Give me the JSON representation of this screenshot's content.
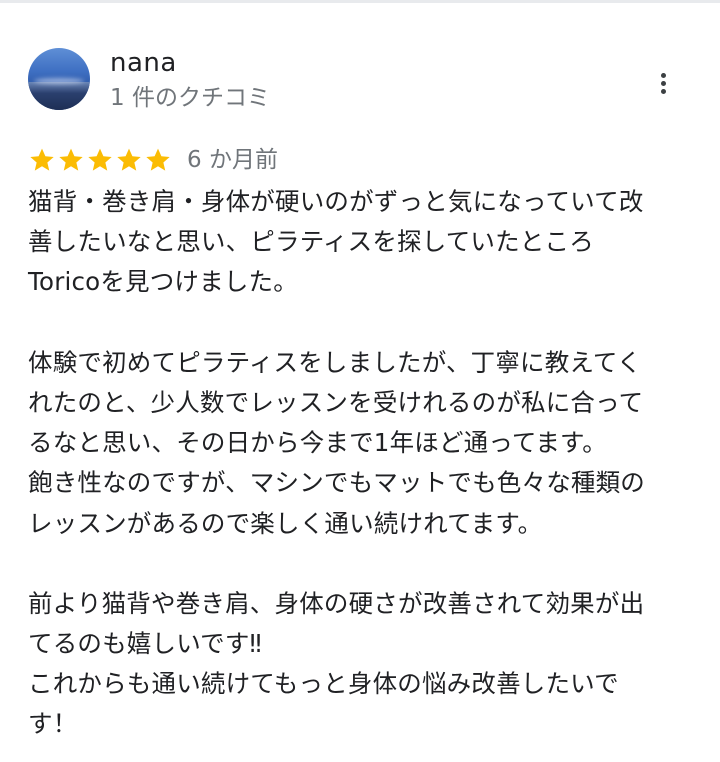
{
  "review": {
    "reviewer_name": "nana",
    "reviewer_meta": "1 件のクチコミ",
    "rating": 5,
    "rating_max": 5,
    "date": "6 か月前",
    "body_lines": [
      "猫背・巻き肩・身体が硬いのがずっと気になっていて改",
      "善したいなと思い、ピラティスを探していたところ",
      "Toricoを見つけました。",
      "",
      "体験で初めてピラティスをしましたが、丁寧に教えてく",
      "れたのと、少人数でレッスンを受けれるのが私に合って",
      "るなと思い、その日から今まで1年ほど通ってます。",
      "飽き性なのですが、マシンでもマットでも色々な種類の",
      "レッスンがあるので楽しく通い続けれてます。",
      "",
      "前より猫背や巻き肩、身体の硬さが改善されて効果が出",
      "てるのも嬉しいです‼",
      "これからも通い続けてもっと身体の悩み改善したいで",
      "す！"
    ]
  },
  "colors": {
    "star": "#fbbc04",
    "text_primary": "#202124",
    "text_secondary": "#70757a"
  },
  "icons": {
    "more": "more-vert-icon",
    "star": "star-icon"
  }
}
